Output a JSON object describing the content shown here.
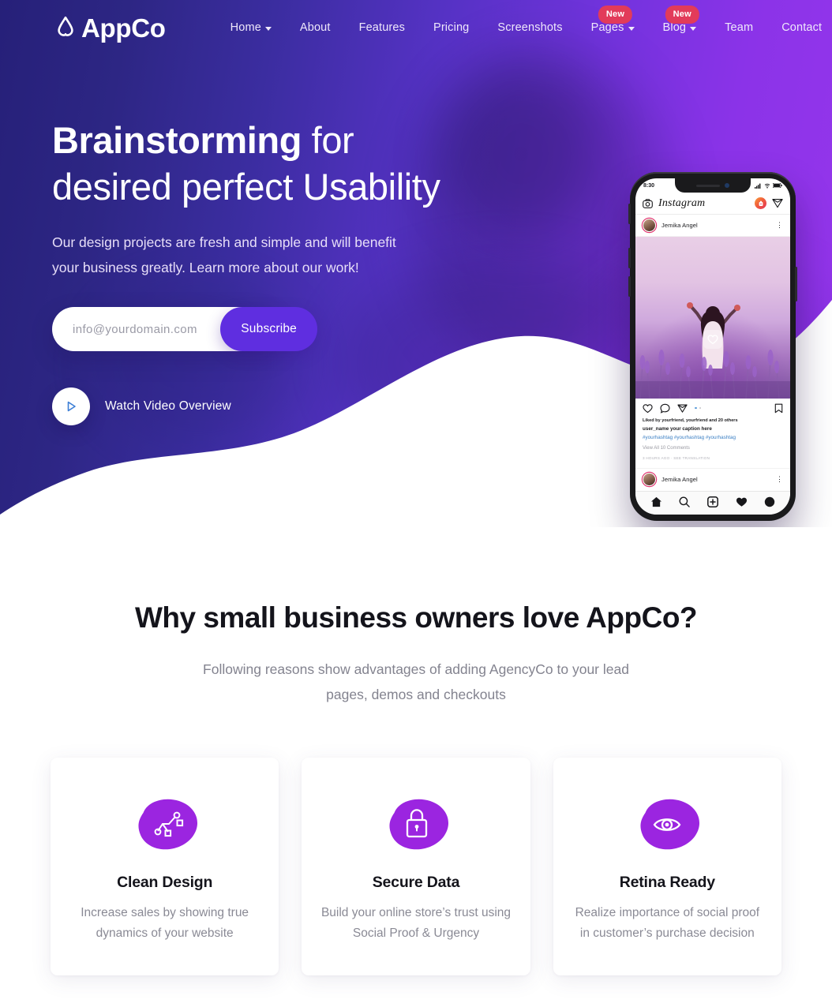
{
  "brand": {
    "logo_text": "AppCo",
    "logo_icon": "appco-mark-icon"
  },
  "nav": {
    "items": [
      {
        "label": "Home",
        "has_caret": true,
        "badge": ""
      },
      {
        "label": "About",
        "has_caret": false,
        "badge": ""
      },
      {
        "label": "Features",
        "has_caret": false,
        "badge": ""
      },
      {
        "label": "Pricing",
        "has_caret": false,
        "badge": ""
      },
      {
        "label": "Screenshots",
        "has_caret": false,
        "badge": ""
      },
      {
        "label": "Pages",
        "has_caret": true,
        "badge": "New"
      },
      {
        "label": "Blog",
        "has_caret": true,
        "badge": "New"
      },
      {
        "label": "Team",
        "has_caret": false,
        "badge": ""
      },
      {
        "label": "Contact",
        "has_caret": false,
        "badge": ""
      }
    ]
  },
  "hero": {
    "title_bold": "Brainstorming",
    "title_rest": " for desired perfect Usability",
    "subtitle": "Our design projects are fresh and simple and will benefit your business greatly. Learn more about our work!",
    "email_placeholder": "info@yourdomain.com",
    "email_value": "",
    "subscribe_label": "Subscribe",
    "video_label": "Watch Video Overview",
    "video_icon": "play-icon",
    "colors": {
      "gradient_start": "#262079",
      "gradient_end": "#9636ec",
      "subscribe_button": "#5f2ee0",
      "badge": "#e23b5a"
    }
  },
  "phone": {
    "status_time": "8:30",
    "app_name": "Instagram",
    "header_icons": [
      "camera-icon",
      "reels-icon",
      "direct-message-icon"
    ],
    "post": {
      "username": "Jemika Angel",
      "menu_icon": "more-vertical-icon",
      "action_icons": [
        "heart-icon",
        "comment-icon",
        "share-icon",
        "bookmark-icon"
      ],
      "likes": "Liked by yourfriend, yourfriend and 20 others",
      "caption": "user_name  your caption here",
      "hashtags": "#yourhashtag #yourhashtag #yourhashtag",
      "view_comments": "View All 10 Comments",
      "timestamp": "3 HOURS AGO · SEE TRANSLATION",
      "footer_username": "Jemika Angel"
    },
    "tabbar_icons": [
      "home-icon",
      "search-icon",
      "add-post-icon",
      "activity-icon",
      "profile-icon"
    ]
  },
  "features": {
    "title": "Why small business owners love AppCo?",
    "subtitle": "Following reasons show advantages of adding AgencyCo to your lead pages, demos and checkouts",
    "cards": [
      {
        "icon": "vector-nodes-icon",
        "title": "Clean Design",
        "text": "Increase sales by showing true dynamics of your website"
      },
      {
        "icon": "lock-icon",
        "title": "Secure Data",
        "text": "Build your online store’s trust using Social Proof & Urgency"
      },
      {
        "icon": "eye-icon",
        "title": "Retina Ready",
        "text": "Realize importance of social proof in customer’s purchase decision"
      }
    ],
    "icon_blob_color": "#9b25e0"
  }
}
